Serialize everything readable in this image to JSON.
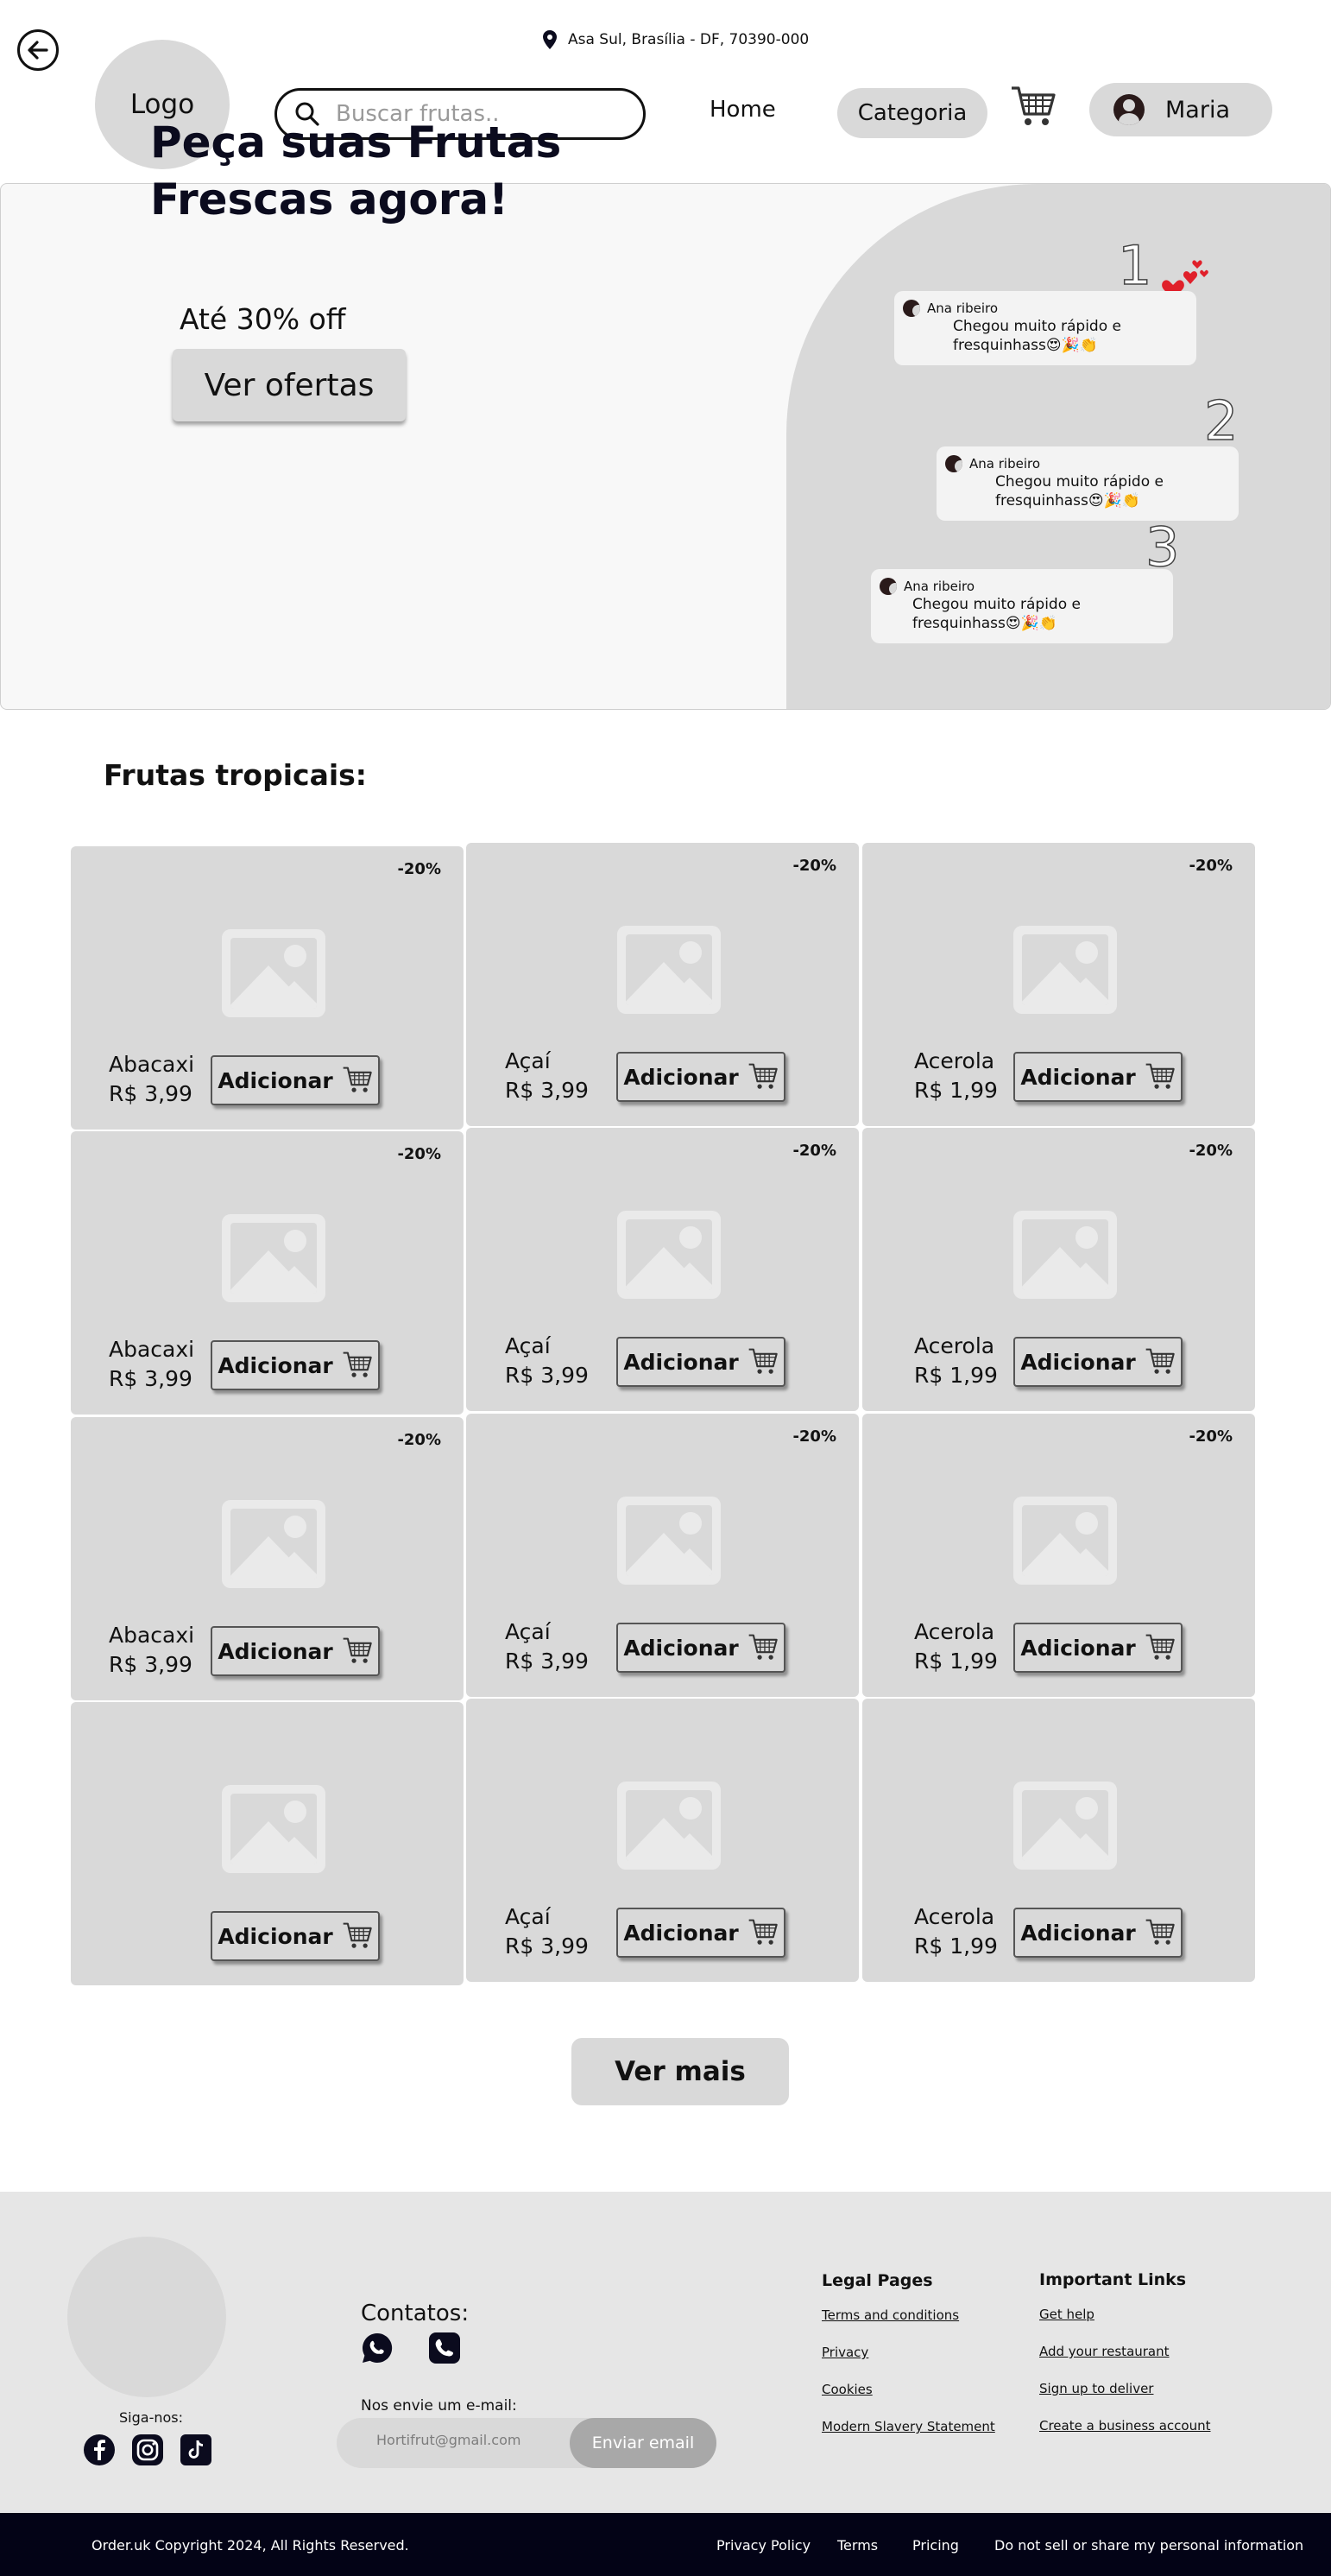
{
  "header": {
    "logo": "Logo",
    "location": "Asa Sul, Brasília - DF, 70390-000",
    "search_placeholder": "Buscar frutas..",
    "nav_home": "Home",
    "nav_category": "Categoria",
    "user_name": "Maria"
  },
  "hero": {
    "title_line1": "Peça suas Frutas",
    "title_line2": "Frescas agora!",
    "subtitle": "Até 30% off",
    "cta": "Ver ofertas",
    "reviews": [
      {
        "number": "1",
        "author": "Ana ribeiro",
        "text_line1": "Chegou muito rápido e",
        "text_line2": "fresquinhass😍🎉👏"
      },
      {
        "number": "2",
        "author": "Ana ribeiro",
        "text_line1": "Chegou muito rápido e",
        "text_line2": "fresquinhass😍🎉👏"
      },
      {
        "number": "3",
        "author": "Ana ribeiro",
        "text_line1": "Chegou muito rápido e",
        "text_line2": "fresquinhass😍🎉👏"
      }
    ]
  },
  "section": {
    "title": "Frutas tropicais:",
    "add_label": "Adicionar",
    "products": [
      {
        "badge": "-20%",
        "name": "Abacaxi",
        "price": "R$ 3,99"
      },
      {
        "badge": "-20%",
        "name": "Açaí",
        "price": "R$ 3,99"
      },
      {
        "badge": "-20%",
        "name": "Acerola",
        "price": "R$ 1,99"
      },
      {
        "badge": "-20%",
        "name": "Abacaxi",
        "price": "R$ 3,99"
      },
      {
        "badge": "-20%",
        "name": "Açaí",
        "price": "R$ 3,99"
      },
      {
        "badge": "-20%",
        "name": "Acerola",
        "price": "R$ 1,99"
      },
      {
        "badge": "-20%",
        "name": "Abacaxi",
        "price": "R$ 3,99"
      },
      {
        "badge": "-20%",
        "name": "Açaí",
        "price": "R$ 3,99"
      },
      {
        "badge": "-20%",
        "name": "Acerola",
        "price": "R$ 1,99"
      },
      {
        "badge": "",
        "name": "",
        "price": ""
      },
      {
        "badge": "",
        "name": "Açaí",
        "price": "R$ 3,99"
      },
      {
        "badge": "",
        "name": "Acerola",
        "price": "R$ 1,99"
      }
    ],
    "more": "Ver mais"
  },
  "footer": {
    "follow": "Siga-nos:",
    "contacts": "Contatos:",
    "email_label": "Nos envie um e-mail:",
    "email_placeholder": "Hortifrut@gmail.com",
    "email_send": "Enviar email",
    "legal_title": "Legal Pages",
    "legal_links": [
      "Terms and conditions",
      "Privacy",
      "Cookies",
      "Modern Slavery Statement"
    ],
    "important_title": "Important Links",
    "important_links": [
      "Get help",
      "Add your restaurant",
      "Sign up to deliver",
      "Create a business account"
    ],
    "copyright": "Order.uk Copyright 2024, All Rights Reserved.",
    "bottom_links": [
      "Privacy Policy",
      "Terms",
      "Pricing",
      "Do not sell or share my personal information"
    ]
  },
  "colors": {
    "panel_gray": "#d9d9d9",
    "footer_bg": "#e6e6e6",
    "bottom_bar": "#030316",
    "heart_red": "#e0202a"
  }
}
